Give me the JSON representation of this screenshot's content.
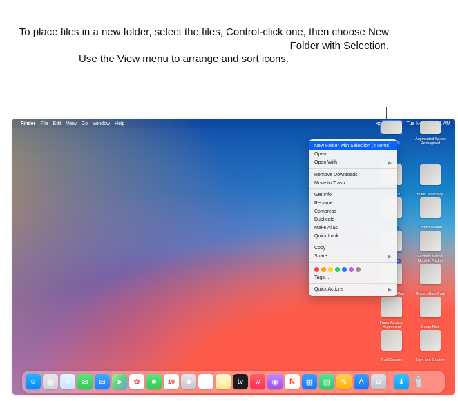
{
  "annotations": {
    "left": "Use the View menu to arrange and sort icons.",
    "right": "To place files in a new folder, select the files, Control-click one, then choose New Folder with Selection."
  },
  "menubar": {
    "apple": "",
    "items": [
      "Finder",
      "File",
      "Edit",
      "View",
      "Go",
      "Window",
      "Help"
    ],
    "status": {
      "wifi": "wifi",
      "spotlight": "search",
      "control_center": "cc",
      "timestamp": "Tue Nov 10  9:41 AM"
    }
  },
  "context_menu": {
    "highlighted": "New Folder with Selection (4 Items)",
    "groups": [
      [
        "Open",
        "Open With"
      ],
      [
        "Remove Downloads",
        "Move to Trash"
      ],
      [
        "Get Info",
        "Rename…",
        "Compress",
        "Duplicate",
        "Make Alias",
        "Quick Look"
      ],
      [
        "Copy",
        "Share"
      ]
    ],
    "tags_label": "Tags…",
    "quick_actions_label": "Quick Actions",
    "tag_colors": [
      "#ff453a",
      "#ff9f0a",
      "#ffd60a",
      "#30d158",
      "#0a84ff",
      "#bf5af2",
      "#8e8e93"
    ]
  },
  "desktop_icons": {
    "columns": [
      [
        {
          "label": "Display 01",
          "selected": true,
          "half": true
        },
        {
          "label": "Display 03",
          "selected": true
        },
        {
          "label": "la Paris",
          "selected": true
        },
        {
          "label": "lo Flower",
          "selected": true
        },
        {
          "label": "Marketing Plan",
          "selected": false
        },
        {
          "label": "Paper Airplane Experiment",
          "selected": false
        },
        {
          "label": "Rail Chasers",
          "selected": false
        }
      ],
      [
        {
          "label": "Augmented Space Reimagined",
          "selected": false,
          "half": true
        },
        {
          "label": "Bland Workshop",
          "selected": false
        },
        {
          "label": "District Market",
          "selected": false
        },
        {
          "label": "Farmers Market Monthly Packet",
          "selected": false
        },
        {
          "label": "Golden Gate Park",
          "selected": false
        },
        {
          "label": "Group Ride",
          "selected": false
        },
        {
          "label": "Light and Shadow",
          "selected": false
        }
      ]
    ]
  },
  "dock": {
    "apps": [
      {
        "name": "Finder",
        "bg": "linear-gradient(180deg,#26b3ff,#0a84ff)",
        "glyph": "☺"
      },
      {
        "name": "Launchpad",
        "bg": "linear-gradient(180deg,#e8e8ec,#cfcfd6)",
        "glyph": "▦"
      },
      {
        "name": "Safari",
        "bg": "linear-gradient(180deg,#e9f4ff,#c6e4ff)",
        "glyph": "✳"
      },
      {
        "name": "Messages",
        "bg": "linear-gradient(180deg,#5ee37a,#2ecc4f)",
        "glyph": "✉"
      },
      {
        "name": "Mail",
        "bg": "linear-gradient(180deg,#4aa8ff,#1d7dff)",
        "glyph": "✉"
      },
      {
        "name": "Maps",
        "bg": "linear-gradient(135deg,#b6f09c,#66d17e 45%,#4baee8)",
        "glyph": "➤"
      },
      {
        "name": "Photos",
        "bg": "#ffffff",
        "glyph": "✿"
      },
      {
        "name": "FaceTime",
        "bg": "linear-gradient(180deg,#5ee37a,#2ecc4f)",
        "glyph": "■"
      },
      {
        "name": "Calendar",
        "bg": "#ffffff",
        "glyph": "10"
      },
      {
        "name": "Contacts",
        "bg": "linear-gradient(180deg,#e6e6ea,#c6c6cd)",
        "glyph": "☻"
      },
      {
        "name": "Reminders",
        "bg": "#ffffff",
        "glyph": "≣"
      },
      {
        "name": "Notes",
        "bg": "linear-gradient(180deg,#fff7d1,#ffe98a)",
        "glyph": "✎"
      },
      {
        "name": "TV",
        "bg": "#1c1c1e",
        "glyph": "tv"
      },
      {
        "name": "Music",
        "bg": "linear-gradient(180deg,#ff5e6a,#ff2d55)",
        "glyph": "♫"
      },
      {
        "name": "Podcasts",
        "bg": "linear-gradient(180deg,#c68bff,#9a4dff)",
        "glyph": "◉"
      },
      {
        "name": "News",
        "bg": "#ffffff",
        "glyph": "N"
      },
      {
        "name": "Keynote",
        "bg": "linear-gradient(180deg,#3aa0ff,#1874ff)",
        "glyph": "▦"
      },
      {
        "name": "Numbers",
        "bg": "linear-gradient(180deg,#59e08f,#2ecc71)",
        "glyph": "▤"
      },
      {
        "name": "Pages",
        "bg": "linear-gradient(180deg,#ffce5c,#ffb300)",
        "glyph": "✎"
      },
      {
        "name": "App Store",
        "bg": "linear-gradient(180deg,#3aa0ff,#1874ff)",
        "glyph": "A"
      },
      {
        "name": "System Preferences",
        "bg": "linear-gradient(180deg,#e2e2e6,#c0c0c8)",
        "glyph": "⚙"
      }
    ],
    "right": [
      {
        "name": "Downloads",
        "bg": "linear-gradient(180deg,#35c3ff,#0a9cff)",
        "glyph": "⬇"
      }
    ]
  }
}
